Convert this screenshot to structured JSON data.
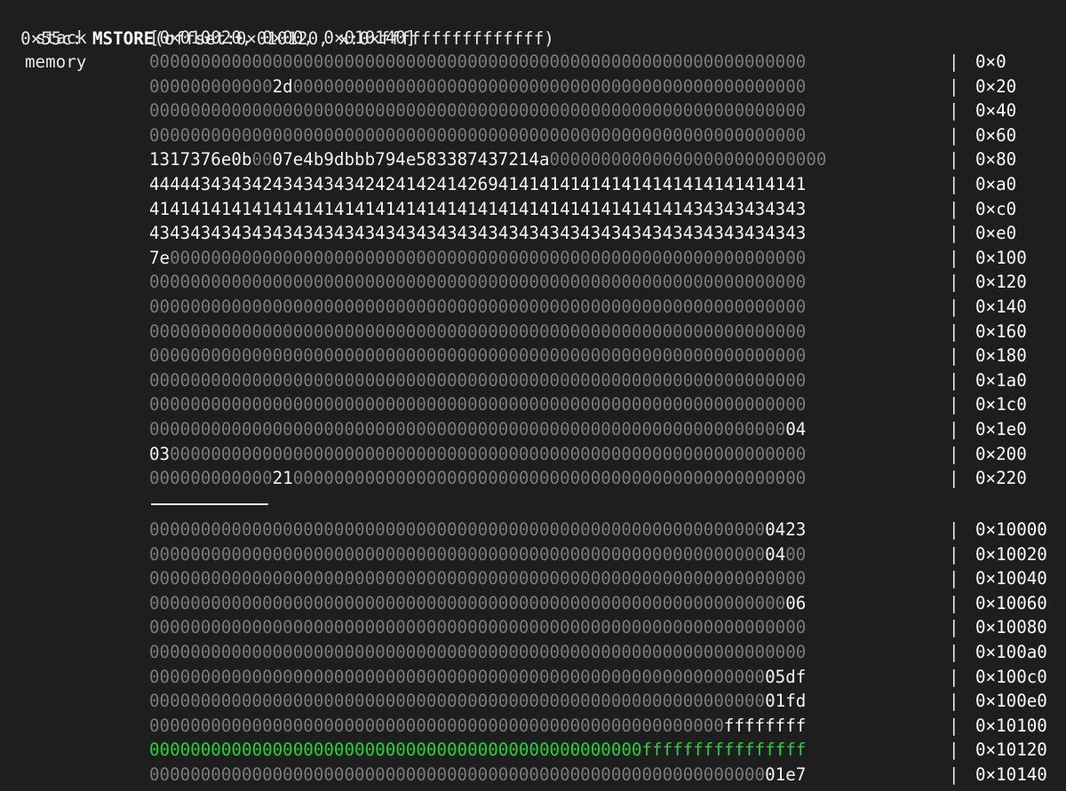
{
  "header": {
    "pc": "0×55c:",
    "opcode": "MSTORE",
    "args": "(offset:0×010120, x:0×ffffffffffffffff)"
  },
  "stack": {
    "label": "stack",
    "value": "[0×010020, 0×00, 0×010140]"
  },
  "memory": {
    "label": "memory",
    "separator": "|",
    "rows": [
      {
        "segments": [
          {
            "t": "0000000000000000000000000000000000000000000000000000000000000000",
            "c": "dim"
          }
        ],
        "addr": "0×0"
      },
      {
        "segments": [
          {
            "t": "000000000000",
            "c": "dim"
          },
          {
            "t": "2d",
            "c": "bright"
          },
          {
            "t": "00000000000000000000000000000000000000000000000000",
            "c": "dim"
          }
        ],
        "addr": "0×20"
      },
      {
        "segments": [
          {
            "t": "0000000000000000000000000000000000000000000000000000000000000000",
            "c": "dim"
          }
        ],
        "addr": "0×40"
      },
      {
        "segments": [
          {
            "t": "0000000000000000000000000000000000000000000000000000000000000000",
            "c": "dim"
          }
        ],
        "addr": "0×60"
      },
      {
        "segments": [
          {
            "t": "1317376e0b",
            "c": "bright"
          },
          {
            "t": "00",
            "c": "dim"
          },
          {
            "t": "07e4b9dbbb794e583387437214a",
            "c": "bright"
          },
          {
            "t": "000000000000000000000000000",
            "c": "dim"
          }
        ],
        "addr": "0×80"
      },
      {
        "segments": [
          {
            "t": "4444434343424343434342424142414269414141414141414141414141414141",
            "c": "bright"
          }
        ],
        "addr": "0×a0"
      },
      {
        "segments": [
          {
            "t": "4141414141414141414141414141414141414141414141414141434343434343",
            "c": "bright"
          }
        ],
        "addr": "0×c0"
      },
      {
        "segments": [
          {
            "t": "4343434343434343434343434343434343434343434343434343434343434343",
            "c": "bright"
          }
        ],
        "addr": "0×e0"
      },
      {
        "segments": [
          {
            "t": "7e",
            "c": "bright"
          },
          {
            "t": "00000000000000000000000000000000000000000000000000000000000000",
            "c": "dim"
          }
        ],
        "addr": "0×100"
      },
      {
        "segments": [
          {
            "t": "0000000000000000000000000000000000000000000000000000000000000000",
            "c": "dim"
          }
        ],
        "addr": "0×120"
      },
      {
        "segments": [
          {
            "t": "0000000000000000000000000000000000000000000000000000000000000000",
            "c": "dim"
          }
        ],
        "addr": "0×140"
      },
      {
        "segments": [
          {
            "t": "0000000000000000000000000000000000000000000000000000000000000000",
            "c": "dim"
          }
        ],
        "addr": "0×160"
      },
      {
        "segments": [
          {
            "t": "0000000000000000000000000000000000000000000000000000000000000000",
            "c": "dim"
          }
        ],
        "addr": "0×180"
      },
      {
        "segments": [
          {
            "t": "0000000000000000000000000000000000000000000000000000000000000000",
            "c": "dim"
          }
        ],
        "addr": "0×1a0"
      },
      {
        "segments": [
          {
            "t": "0000000000000000000000000000000000000000000000000000000000000000",
            "c": "dim"
          }
        ],
        "addr": "0×1c0"
      },
      {
        "segments": [
          {
            "t": "00000000000000000000000000000000000000000000000000000000000000",
            "c": "dim"
          },
          {
            "t": "04",
            "c": "bright"
          }
        ],
        "addr": "0×1e0"
      },
      {
        "segments": [
          {
            "t": "03",
            "c": "bright"
          },
          {
            "t": "00000000000000000000000000000000000000000000000000000000000000",
            "c": "dim"
          }
        ],
        "addr": "0×200"
      },
      {
        "segments": [
          {
            "t": "000000000000",
            "c": "dim"
          },
          {
            "t": "21",
            "c": "bright"
          },
          {
            "t": "00000000000000000000000000000000000000000000000000",
            "c": "dim"
          }
        ],
        "addr": "0×220"
      }
    ],
    "high_rows": [
      {
        "segments": [
          {
            "t": "000000000000000000000000000000000000000000000000000000000000",
            "c": "dim"
          },
          {
            "t": "0423",
            "c": "bright"
          }
        ],
        "addr": "0×10000"
      },
      {
        "segments": [
          {
            "t": "000000000000000000000000000000000000000000000000000000000000",
            "c": "dim"
          },
          {
            "t": "04",
            "c": "bright"
          },
          {
            "t": "00",
            "c": "dim"
          }
        ],
        "addr": "0×10020"
      },
      {
        "segments": [
          {
            "t": "0000000000000000000000000000000000000000000000000000000000000000",
            "c": "dim"
          }
        ],
        "addr": "0×10040"
      },
      {
        "segments": [
          {
            "t": "00000000000000000000000000000000000000000000000000000000000000",
            "c": "dim"
          },
          {
            "t": "06",
            "c": "bright"
          }
        ],
        "addr": "0×10060"
      },
      {
        "segments": [
          {
            "t": "0000000000000000000000000000000000000000000000000000000000000000",
            "c": "dim"
          }
        ],
        "addr": "0×10080"
      },
      {
        "segments": [
          {
            "t": "0000000000000000000000000000000000000000000000000000000000000000",
            "c": "dim"
          }
        ],
        "addr": "0×100a0"
      },
      {
        "segments": [
          {
            "t": "000000000000000000000000000000000000000000000000000000000000",
            "c": "dim"
          },
          {
            "t": "05df",
            "c": "bright"
          }
        ],
        "addr": "0×100c0"
      },
      {
        "segments": [
          {
            "t": "000000000000000000000000000000000000000000000000000000000000",
            "c": "dim"
          },
          {
            "t": "01fd",
            "c": "bright"
          }
        ],
        "addr": "0×100e0"
      },
      {
        "segments": [
          {
            "t": "00000000000000000000000000000000000000000000000000000000",
            "c": "dim"
          },
          {
            "t": "ffffffff",
            "c": "bright"
          }
        ],
        "addr": "0×10100"
      },
      {
        "segments": [
          {
            "t": "000000000000000000000000000000000000000000000000ffffffffffffffff",
            "c": "green"
          }
        ],
        "addr": "0×10120"
      },
      {
        "segments": [
          {
            "t": "000000000000000000000000000000000000000000000000000000000000",
            "c": "dim"
          },
          {
            "t": "01e7",
            "c": "bright"
          }
        ],
        "addr": "0×10140"
      }
    ]
  }
}
